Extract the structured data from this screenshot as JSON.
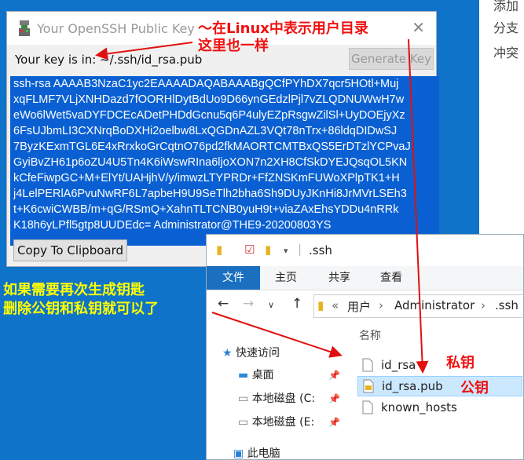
{
  "right_strip": {
    "lines": [
      "添加",
      "分支",
      "冲突"
    ]
  },
  "dialog": {
    "title": "Your OpenSSH Public Key",
    "key_location_label": "Your key is in: ~/.ssh/id_rsa.pub",
    "generate_button": "Generate Key",
    "copy_button": "Copy To Clipboard",
    "key_lines": [
      "ssh-rsa AAAAB3NzaC1yc2EAAAADAQABAAABgQCfPYhDX7qcr5HOtl+Muj",
      "xqFLMF7VLjXNHDazd7fOORHlDytBdUo9D66ynGEdzlPjl7vZLQDNUWwH7w",
      "eWo6lWet5vaDYFDCEcADetPHDdGcnu5q6P4ulyEZpRsgwZilSl+UyDOEjyXz",
      "6FsUJbmLI3CXNrqBoDXHi2oelbw8LxQGDnAZL3VQt78nTrx+86ldqDIDwSJ",
      "7ByzKExmTGL6E4xRrxkoGrCqtnO76pd2fkMAORTCMTBxQS5ErDTzlYCPvaJ",
      "GyiBvZH61p6oZU4U5Tn4K6iWswRIna6ljoXON7n2XH8CfSkDYEJQsqOL5KN",
      "kCfeFiwpGC+M+ElYt/UAHjhV/y/imwzLTYPRDr+FfZNSKmFUWoXPlpTK1+H",
      "j4LelPERlA6PvuNwRF6L7apbeH9U9SeTlh2bha6Sh9DUyJKnHi8JrMVrLSEh3",
      "t+K6cwiCWBB/m+qG/RSmQ+XahnTLTCNB0yuH9t+viaZAxEhsYDDu4nRRk",
      "K18h6yLPfl5gtp8UUDEdc= Administrator@THE9-20200803YS"
    ]
  },
  "explorer": {
    "title_path": ".ssh",
    "ribbon_tabs": [
      "文件",
      "主页",
      "共享",
      "查看"
    ],
    "address": {
      "chevrons": "«",
      "segments": [
        "用户",
        "Administrator",
        ".ssh"
      ],
      "sep": "›"
    },
    "sidebar": [
      {
        "label": "快速访问",
        "icon": "star-icon"
      },
      {
        "label": "桌面",
        "icon": "desktop-icon"
      },
      {
        "label": "本地磁盘 (C:",
        "icon": "drive-icon"
      },
      {
        "label": "本地磁盘 (E:",
        "icon": "drive-icon"
      },
      {
        "label": "此电脑",
        "icon": "computer-icon"
      }
    ],
    "column_header": "名称",
    "files": [
      {
        "name": "id_rsa",
        "icon": "file-icon",
        "selected": false
      },
      {
        "name": "id_rsa.pub",
        "icon": "pub-file-icon",
        "selected": true
      },
      {
        "name": "known_hosts",
        "icon": "file-icon",
        "selected": false
      }
    ]
  },
  "annotations": {
    "linux_note_1": "～在Linux中表示用户目录",
    "linux_note_2": "这里也一样",
    "regen_note_1": "如果需要再次生成钥匙",
    "regen_note_2": "删除公钥和私钥就可以了",
    "private_key": "私钥",
    "public_key": "公钥"
  },
  "colors": {
    "background_blue": "#0f73c9",
    "key_selection": "#0a60d2",
    "annotation_red": "#f01010",
    "annotation_yellow": "#ffff00"
  }
}
